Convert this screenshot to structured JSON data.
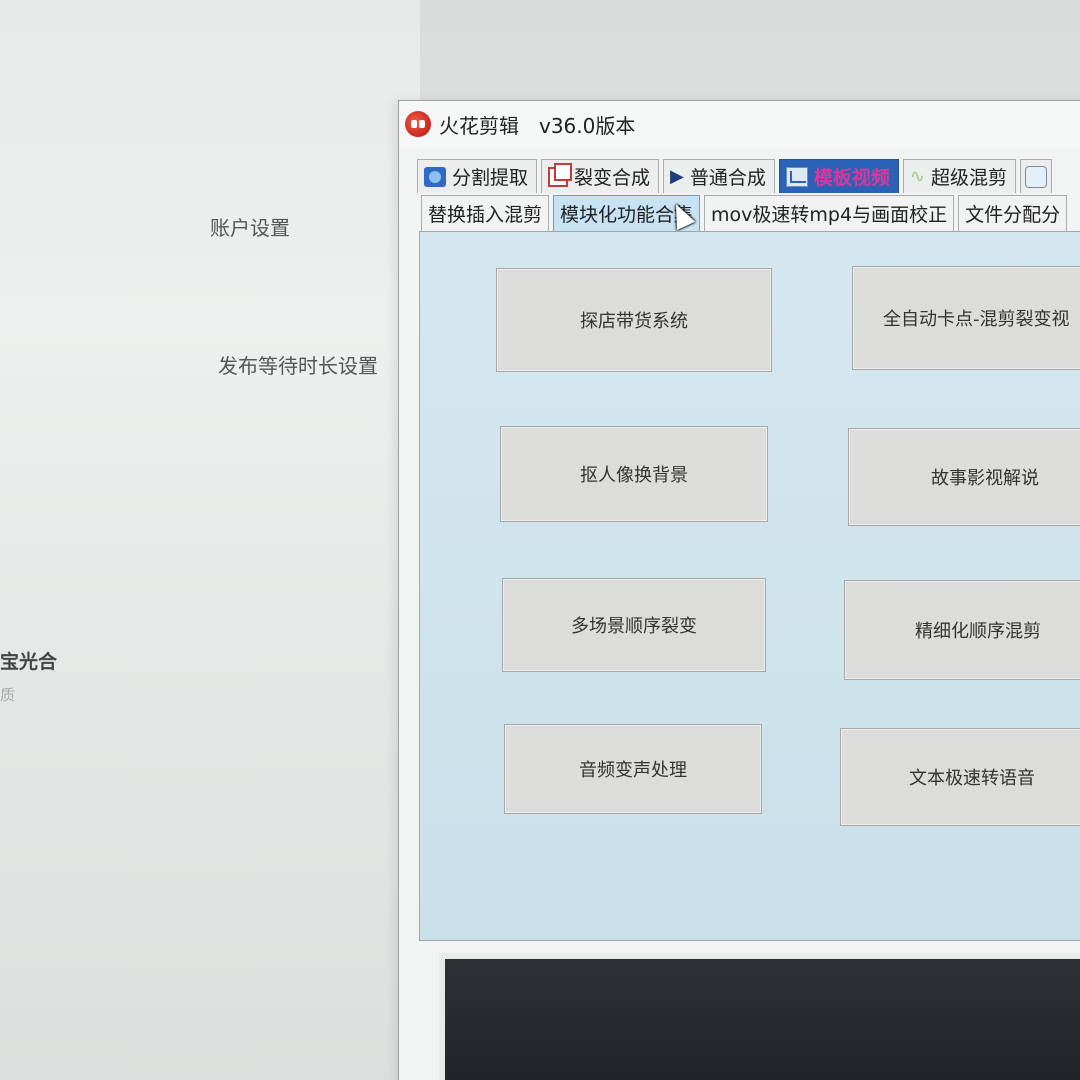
{
  "background_page": {
    "labels": {
      "account_settings": "账户设置",
      "publish_wait_settings": "发布等待时长设置",
      "side_text": "宝光合",
      "side_faint": "质"
    }
  },
  "window": {
    "app_title": "火花剪辑",
    "version": "v36.0版本",
    "tabs_primary": [
      {
        "label": "分割提取",
        "icon": "film-icon"
      },
      {
        "label": "裂变合成",
        "icon": "copy-icon"
      },
      {
        "label": "普通合成",
        "icon": "play-icon"
      },
      {
        "label": "模板视频",
        "icon": "chart-icon",
        "active": true
      },
      {
        "label": "超级混剪",
        "icon": "wave-icon"
      }
    ],
    "tabs_secondary": [
      {
        "label": "替换插入混剪"
      },
      {
        "label": "模块化功能合集",
        "active": true
      },
      {
        "label": "mov极速转mp4与画面校正"
      },
      {
        "label": "文件分配分"
      }
    ],
    "function_buttons": [
      {
        "label": "探店带货系统"
      },
      {
        "label": "全自动卡点-混剪裂变视"
      },
      {
        "label": "抠人像换背景"
      },
      {
        "label": "故事影视解说"
      },
      {
        "label": "多场景顺序裂变"
      },
      {
        "label": "精细化顺序混剪"
      },
      {
        "label": "音频变声处理"
      },
      {
        "label": "文本极速转语音"
      }
    ]
  }
}
